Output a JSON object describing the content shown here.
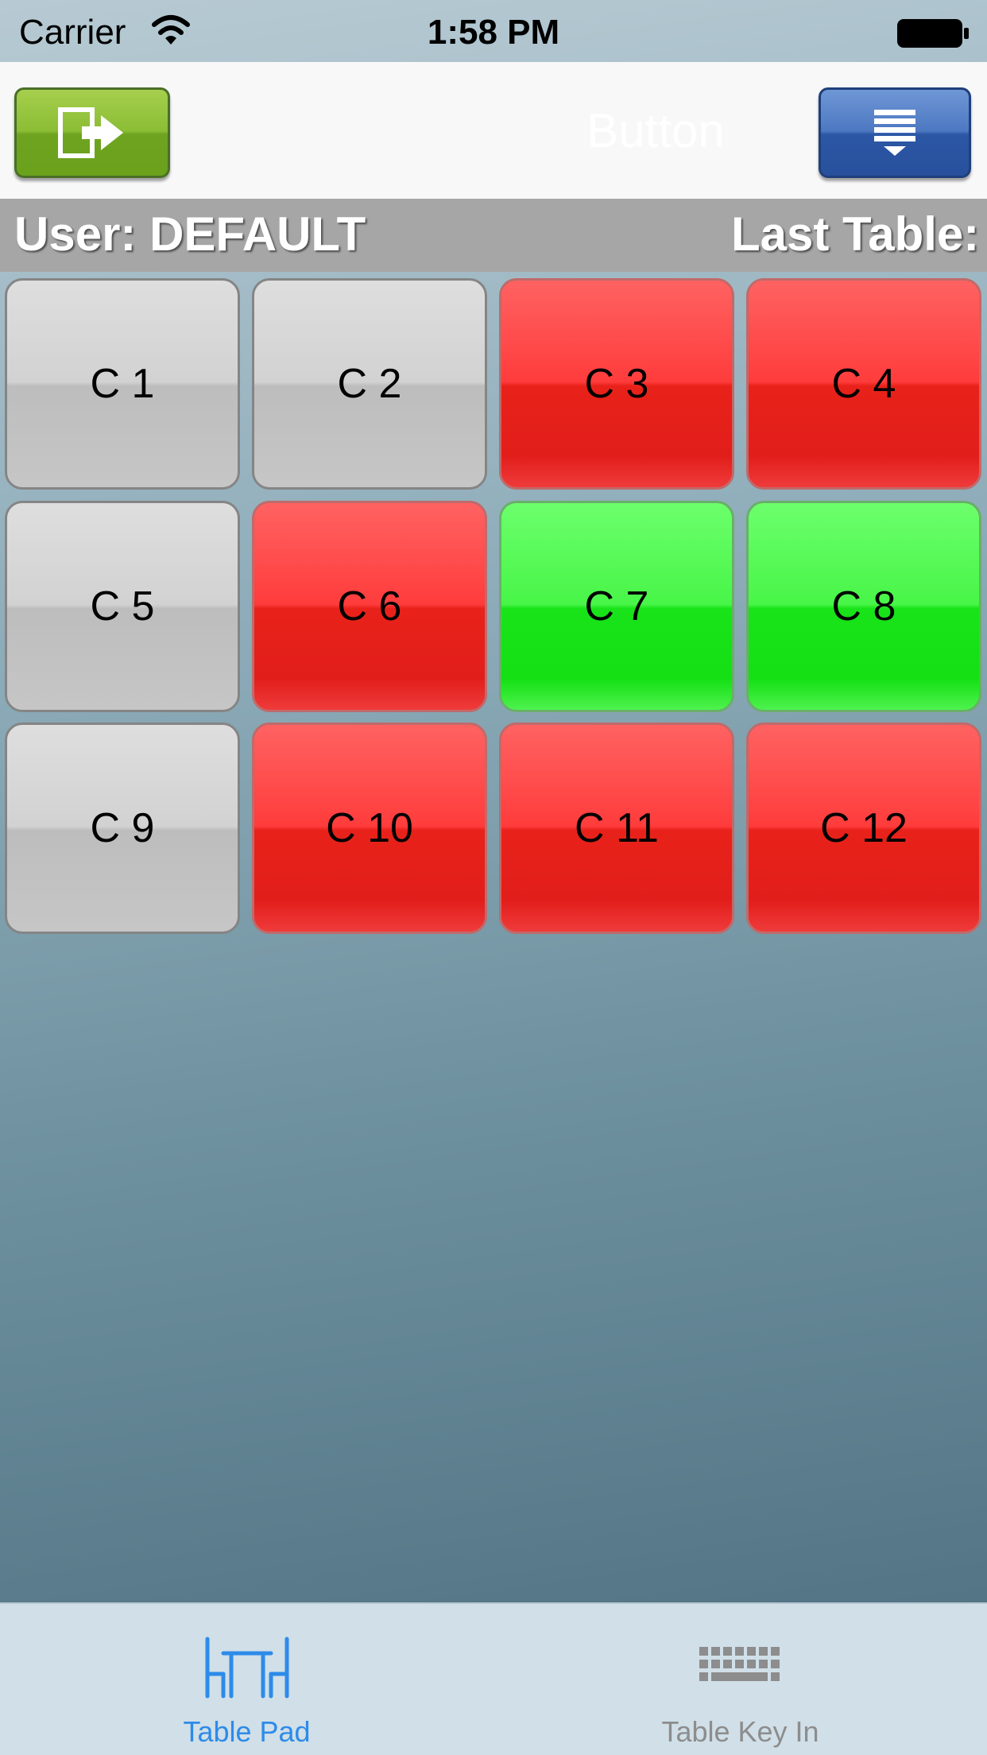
{
  "status_bar": {
    "carrier": "Carrier",
    "time": "1:58 PM"
  },
  "nav_bar": {
    "center_button_label": "Button",
    "logout_icon": "logout-icon",
    "menu_icon": "menu-list-icon"
  },
  "info_bar": {
    "user_label": "User: DEFAULT",
    "last_table_label": "Last Table:"
  },
  "tables": [
    {
      "label": "C 1",
      "status": "gray"
    },
    {
      "label": "C 2",
      "status": "gray"
    },
    {
      "label": "C 3",
      "status": "red"
    },
    {
      "label": "C 4",
      "status": "red"
    },
    {
      "label": "C 5",
      "status": "gray"
    },
    {
      "label": "C 6",
      "status": "red"
    },
    {
      "label": "C 7",
      "status": "green"
    },
    {
      "label": "C 8",
      "status": "green"
    },
    {
      "label": "C 9",
      "status": "gray"
    },
    {
      "label": "C 10",
      "status": "red"
    },
    {
      "label": "C 11",
      "status": "red"
    },
    {
      "label": "C 12",
      "status": "red"
    }
  ],
  "tab_bar": {
    "items": [
      {
        "label": "Table Pad",
        "icon": "table-chairs-icon",
        "selected": true
      },
      {
        "label": "Table Key In",
        "icon": "keyboard-icon",
        "selected": false
      }
    ]
  },
  "colors": {
    "tab_selected": "#2d8be9",
    "tab_unselected": "#8d8d8d"
  }
}
